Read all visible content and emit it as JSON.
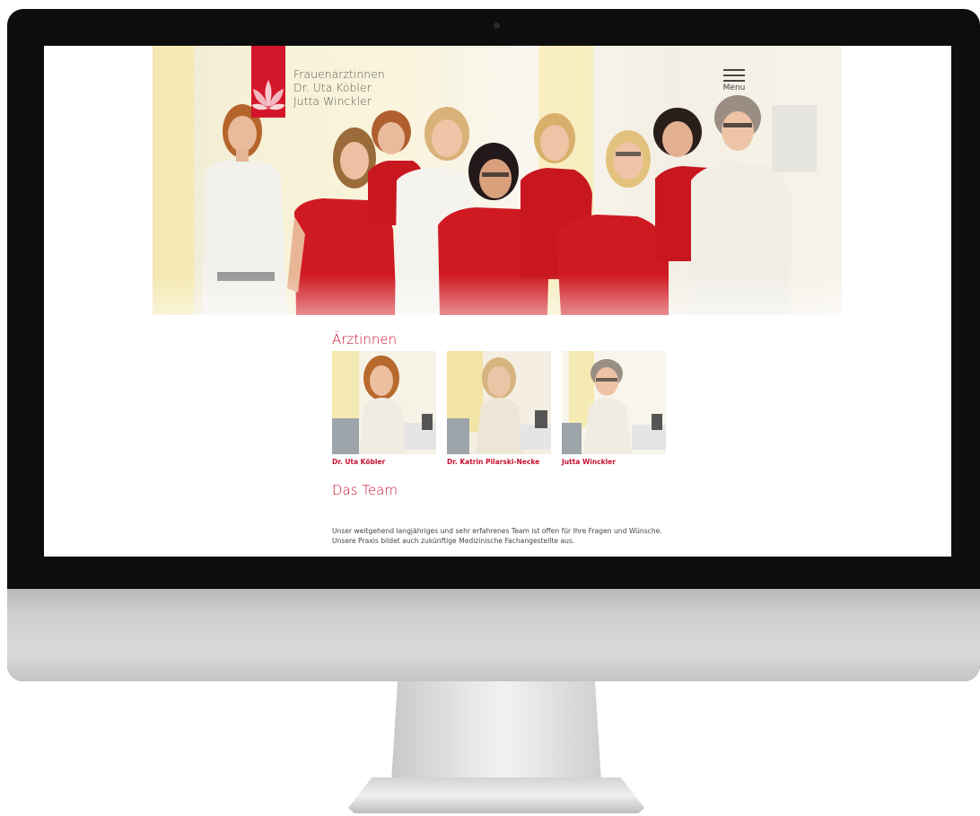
{
  "site": {
    "brand_lines": [
      "Frauenärztinnen",
      "Dr. Uta Köbler",
      "Jutta Winckler"
    ],
    "menu_label": "Menu"
  },
  "doctors_section": {
    "title": "Ärztinnen",
    "doctors": [
      {
        "name": "Dr. Uta Köbler"
      },
      {
        "name": "Dr. Katrin Pilarski-Necke"
      },
      {
        "name": "Jutta Winckler"
      }
    ]
  },
  "team_section": {
    "title": "Das Team",
    "text": "Unser weitgehend langjähriges und sehr erfahrenes Team ist offen für Ihre Fragen und Wünsche. Unsere Praxis bildet auch zukünftige Medizinische Fachangestellte aus."
  },
  "colors": {
    "accent": "#c8102e",
    "logo_red": "#d3162a",
    "scrub_red": "#d01a22",
    "bezel": "#0d0d0d"
  }
}
